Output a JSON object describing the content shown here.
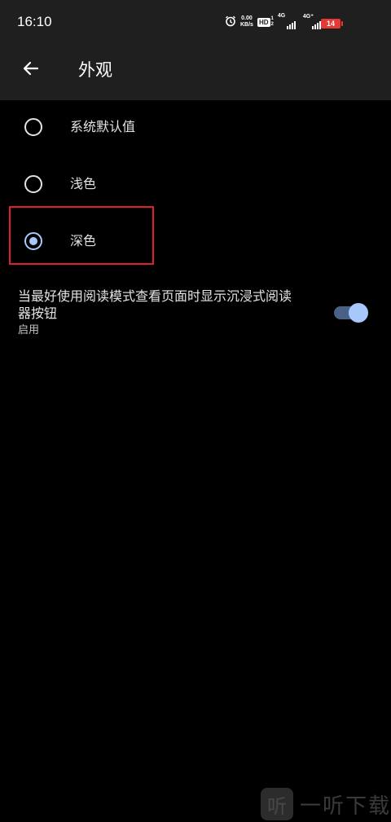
{
  "status_bar": {
    "time": "16:10",
    "net_speed_value": "0.00",
    "net_speed_unit": "KB/s",
    "hd_label": "HD",
    "hd_num_top": "1",
    "hd_num_bottom": "2",
    "sim1_network": "4G",
    "sim2_network": "4G⁺",
    "battery_level": "14",
    "battery_color": "#e53935",
    "icons": [
      "alarm-icon",
      "signal-icon",
      "battery-icon"
    ]
  },
  "app_bar": {
    "title": "外观",
    "back_icon": "arrow-left-icon"
  },
  "theme_options": [
    {
      "label": "系统默认值",
      "selected": false
    },
    {
      "label": "浅色",
      "selected": false
    },
    {
      "label": "深色",
      "selected": true
    }
  ],
  "reader_button_setting": {
    "title": "当最好使用阅读模式查看页面时显示沉浸式阅读器按钮",
    "subtitle": "启用",
    "enabled": true
  },
  "colors": {
    "background": "#000000",
    "bar_background": "#1f1f1f",
    "accent": "#a8c7fa",
    "highlight_border": "#e0202a"
  },
  "watermark": {
    "logo_char": "听",
    "text": "一听下载"
  }
}
